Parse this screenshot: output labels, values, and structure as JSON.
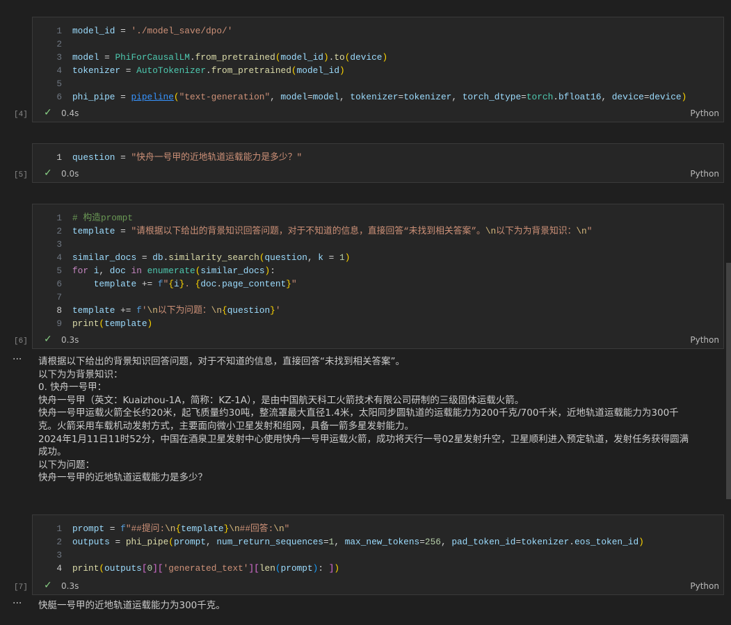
{
  "cells": [
    {
      "count": "[4]",
      "time": "0.4s",
      "language": "Python",
      "current_line": 0,
      "lines": [
        [
          [
            "var",
            "model_id"
          ],
          [
            "op",
            " = "
          ],
          [
            "str",
            "'./model_save/dpo/'"
          ]
        ],
        [],
        [
          [
            "var",
            "model"
          ],
          [
            "op",
            " = "
          ],
          [
            "cls",
            "PhiForCausalLM"
          ],
          [
            "op",
            "."
          ],
          [
            "fn",
            "from_pretrained"
          ],
          [
            "b1",
            "("
          ],
          [
            "var",
            "model_id"
          ],
          [
            "b1",
            ")"
          ],
          [
            "op",
            "."
          ],
          [
            "fn",
            "to"
          ],
          [
            "b1",
            "("
          ],
          [
            "var",
            "device"
          ],
          [
            "b1",
            ")"
          ]
        ],
        [
          [
            "var",
            "tokenizer"
          ],
          [
            "op",
            " = "
          ],
          [
            "cls",
            "AutoTokenizer"
          ],
          [
            "op",
            "."
          ],
          [
            "fn",
            "from_pretrained"
          ],
          [
            "b1",
            "("
          ],
          [
            "var",
            "model_id"
          ],
          [
            "b1",
            ")"
          ]
        ],
        [],
        [
          [
            "var",
            "phi_pipe"
          ],
          [
            "op",
            " = "
          ],
          [
            "link",
            "pipeline"
          ],
          [
            "b1",
            "("
          ],
          [
            "str",
            "\"text-generation\""
          ],
          [
            "op",
            ", "
          ],
          [
            "var",
            "model"
          ],
          [
            "op",
            "="
          ],
          [
            "var",
            "model"
          ],
          [
            "op",
            ", "
          ],
          [
            "var",
            "tokenizer"
          ],
          [
            "op",
            "="
          ],
          [
            "var",
            "tokenizer"
          ],
          [
            "op",
            ", "
          ],
          [
            "var",
            "torch_dtype"
          ],
          [
            "op",
            "="
          ],
          [
            "cls",
            "torch"
          ],
          [
            "op",
            "."
          ],
          [
            "var",
            "bfloat16"
          ],
          [
            "op",
            ", "
          ],
          [
            "var",
            "device"
          ],
          [
            "op",
            "="
          ],
          [
            "var",
            "device"
          ],
          [
            "b1",
            ")"
          ]
        ]
      ]
    },
    {
      "count": "[5]",
      "time": "0.0s",
      "language": "Python",
      "current_line": 1,
      "lines": [
        [
          [
            "var",
            "question"
          ],
          [
            "op",
            " = "
          ],
          [
            "str",
            "\"快舟一号甲的近地轨道运载能力是多少？\""
          ]
        ]
      ]
    },
    {
      "count": "[6]",
      "time": "0.3s",
      "language": "Python",
      "current_line": 8,
      "lines": [
        [
          [
            "cmt",
            "# 构造prompt"
          ]
        ],
        [
          [
            "var",
            "template"
          ],
          [
            "op",
            " = "
          ],
          [
            "str",
            "\"请根据以下给出的背景知识回答问题，对于不知道的信息，直接回答“未找到相关答案”。"
          ],
          [
            "esc",
            "\\n"
          ],
          [
            "str",
            "以下为为背景知识："
          ],
          [
            "esc",
            "\\n"
          ],
          [
            "str",
            "\""
          ]
        ],
        [],
        [
          [
            "var",
            "similar_docs"
          ],
          [
            "op",
            " = "
          ],
          [
            "var",
            "db"
          ],
          [
            "op",
            "."
          ],
          [
            "fn",
            "similarity_search"
          ],
          [
            "b1",
            "("
          ],
          [
            "var",
            "question"
          ],
          [
            "op",
            ", "
          ],
          [
            "var",
            "k"
          ],
          [
            "op",
            " = "
          ],
          [
            "num",
            "1"
          ],
          [
            "b1",
            ")"
          ]
        ],
        [
          [
            "kw",
            "for"
          ],
          [
            "op",
            " "
          ],
          [
            "var",
            "i"
          ],
          [
            "op",
            ", "
          ],
          [
            "var",
            "doc"
          ],
          [
            "op",
            " "
          ],
          [
            "kw",
            "in"
          ],
          [
            "op",
            " "
          ],
          [
            "cls",
            "enumerate"
          ],
          [
            "b1",
            "("
          ],
          [
            "var",
            "similar_docs"
          ],
          [
            "b1",
            ")"
          ],
          [
            "op",
            ":"
          ]
        ],
        [
          [
            "op",
            "    "
          ],
          [
            "var",
            "template"
          ],
          [
            "op",
            " += "
          ],
          [
            "f",
            "f"
          ],
          [
            "str",
            "\""
          ],
          [
            "b1",
            "{"
          ],
          [
            "var",
            "i"
          ],
          [
            "b1",
            "}"
          ],
          [
            "str",
            ". "
          ],
          [
            "b1",
            "{"
          ],
          [
            "var",
            "doc"
          ],
          [
            "op",
            "."
          ],
          [
            "var",
            "page_content"
          ],
          [
            "b1",
            "}"
          ],
          [
            "str",
            "\""
          ]
        ],
        [],
        [
          [
            "var",
            "template"
          ],
          [
            "op",
            " += "
          ],
          [
            "f",
            "f"
          ],
          [
            "str",
            "'"
          ],
          [
            "esc",
            "\\n"
          ],
          [
            "str",
            "以下为问题："
          ],
          [
            "esc",
            "\\n"
          ],
          [
            "b1",
            "{"
          ],
          [
            "var",
            "question"
          ],
          [
            "b1",
            "}"
          ],
          [
            "str",
            "'"
          ]
        ],
        [
          [
            "fn",
            "print"
          ],
          [
            "b1",
            "("
          ],
          [
            "var",
            "template"
          ],
          [
            "b1",
            ")"
          ]
        ]
      ]
    },
    {
      "count": "[7]",
      "time": "0.3s",
      "language": "Python",
      "current_line": 4,
      "lines": [
        [
          [
            "var",
            "prompt"
          ],
          [
            "op",
            " = "
          ],
          [
            "f",
            "f"
          ],
          [
            "str",
            "\"##提问:"
          ],
          [
            "esc",
            "\\n"
          ],
          [
            "b1",
            "{"
          ],
          [
            "var",
            "template"
          ],
          [
            "b1",
            "}"
          ],
          [
            "esc",
            "\\n"
          ],
          [
            "str",
            "##回答:"
          ],
          [
            "esc",
            "\\n"
          ],
          [
            "str",
            "\""
          ]
        ],
        [
          [
            "var",
            "outputs"
          ],
          [
            "op",
            " = "
          ],
          [
            "fn",
            "phi_pipe"
          ],
          [
            "b1",
            "("
          ],
          [
            "var",
            "prompt"
          ],
          [
            "op",
            ", "
          ],
          [
            "var",
            "num_return_sequences"
          ],
          [
            "op",
            "="
          ],
          [
            "num",
            "1"
          ],
          [
            "op",
            ", "
          ],
          [
            "var",
            "max_new_tokens"
          ],
          [
            "op",
            "="
          ],
          [
            "num",
            "256"
          ],
          [
            "op",
            ", "
          ],
          [
            "var",
            "pad_token_id"
          ],
          [
            "op",
            "="
          ],
          [
            "var",
            "tokenizer"
          ],
          [
            "op",
            "."
          ],
          [
            "var",
            "eos_token_id"
          ],
          [
            "b1",
            ")"
          ]
        ],
        [],
        [
          [
            "fn",
            "print"
          ],
          [
            "b1",
            "("
          ],
          [
            "var",
            "outputs"
          ],
          [
            "b2",
            "["
          ],
          [
            "num",
            "0"
          ],
          [
            "b2",
            "]"
          ],
          [
            "b2",
            "["
          ],
          [
            "str",
            "'generated_text'"
          ],
          [
            "b2",
            "]"
          ],
          [
            "b2",
            "["
          ],
          [
            "fn",
            "len"
          ],
          [
            "b3",
            "("
          ],
          [
            "var",
            "prompt"
          ],
          [
            "b3",
            ")"
          ],
          [
            "op",
            ": "
          ],
          [
            "b2",
            "]"
          ],
          [
            "b1",
            ")"
          ]
        ]
      ]
    }
  ],
  "outputs": {
    "menu_icon": "ellipsis-icon",
    "cell6": "请根据以下给出的背景知识回答问题，对于不知道的信息，直接回答“未找到相关答案”。\n以下为为背景知识：\n0. 快舟一号甲：\n快舟一号甲（英文：Kuaizhou-1A，简称：KZ-1A），是由中国航天科工火箭技术有限公司研制的三级固体运载火箭。\n快舟一号甲运载火箭全长约20米，起飞质量约30吨，整流罩最大直径1.4米，太阳同步圆轨道的运载能力为200千克/700千米，近地轨道运载能力为300千\n克。火箭采用车载机动发射方式，主要面向微小卫星发射和组网，具备一箭多星发射能力。\n2024年1月11日11时52分，中国在酒泉卫星发射中心使用快舟一号甲运载火箭，成功将天行一号02星发射升空，卫星顺利进入预定轨道，发射任务获得圆满\n成功。\n以下为问题：\n快舟一号甲的近地轨道运载能力是多少？",
    "cell7": "快艇一号甲的近地轨道运载能力为300千克。",
    "dots": "···"
  }
}
